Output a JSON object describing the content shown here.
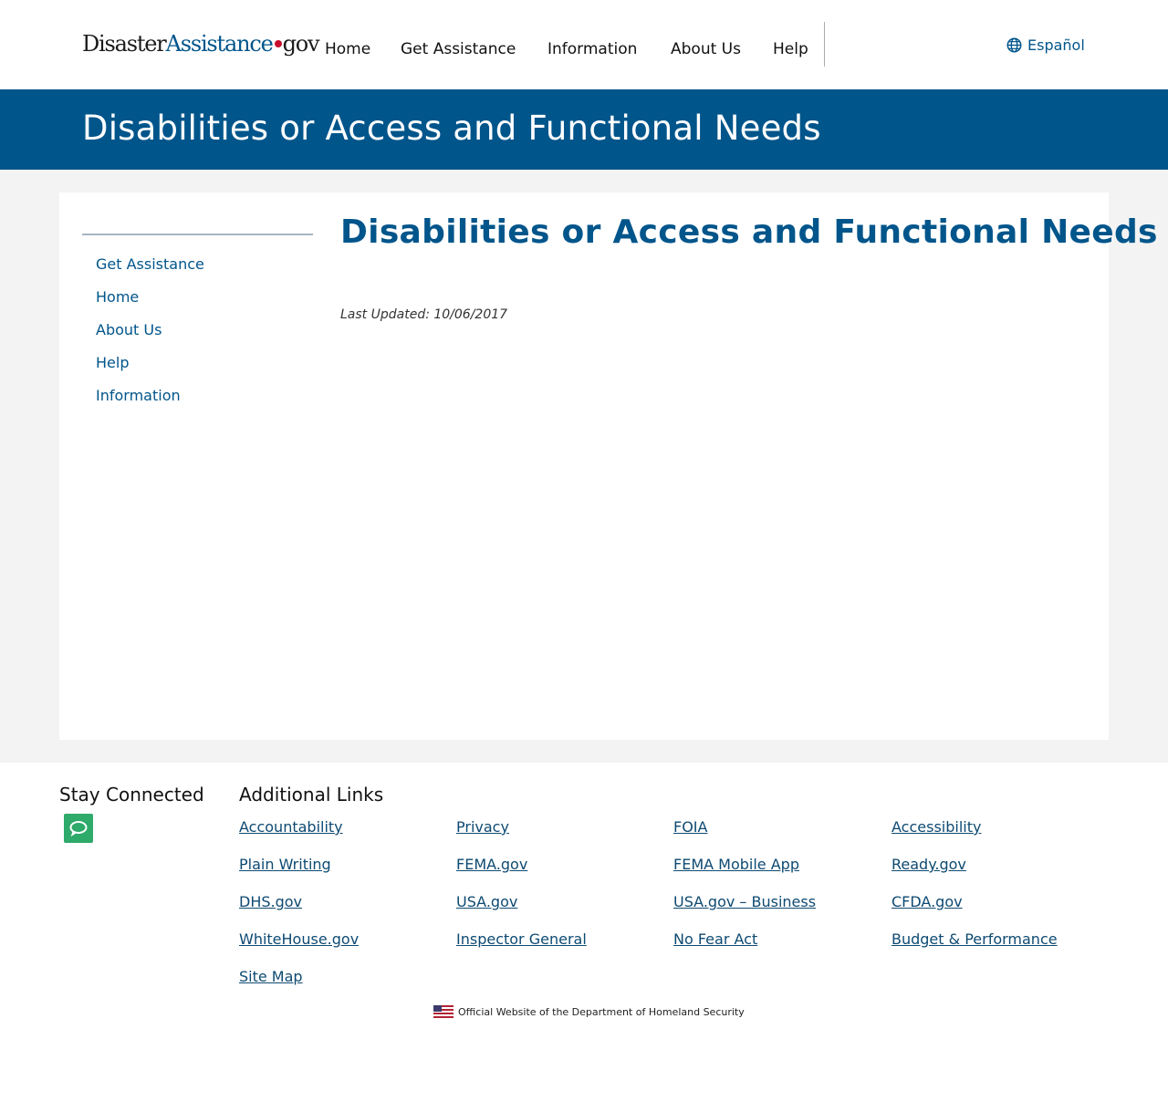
{
  "header": {
    "logo": {
      "part1": "Disaster",
      "part2": "Assistance",
      "part3": "gov"
    },
    "nav": [
      "Home",
      "Get Assistance",
      "Information",
      "About Us",
      "Help"
    ],
    "language_link": "Español"
  },
  "banner": {
    "title": "Disabilities or Access and Functional Needs"
  },
  "sidebar": {
    "items": [
      "Get Assistance",
      "Home",
      "About Us",
      "Help",
      "Information"
    ]
  },
  "main": {
    "title": "Disabilities or Access and Functional Needs",
    "last_updated": "Last Updated: 10/06/2017"
  },
  "footer": {
    "stay_connected": "Stay Connected",
    "additional_links_heading": "Additional Links",
    "links": [
      "Accountability",
      "Privacy",
      "FOIA",
      "Accessibility",
      "Plain Writing",
      "FEMA.gov",
      "FEMA Mobile App",
      "Ready.gov",
      "DHS.gov",
      "USA.gov",
      "USA.gov – Business",
      "CFDA.gov",
      "WhiteHouse.gov",
      "Inspector General",
      "No Fear Act",
      "Budget & Performance",
      "Site Map"
    ],
    "official": "Official Website of the Department of Homeland Security"
  },
  "colors": {
    "brand_blue": "#00558b",
    "link_blue": "#0e4a72",
    "background_gray": "#f3f3f3",
    "chat_green": "#2eaa6a",
    "logo_dot_red": "#c8102e"
  },
  "icons": {
    "language": "globe-icon",
    "chat": "chat-bubble-icon",
    "official": "us-flag-icon"
  }
}
